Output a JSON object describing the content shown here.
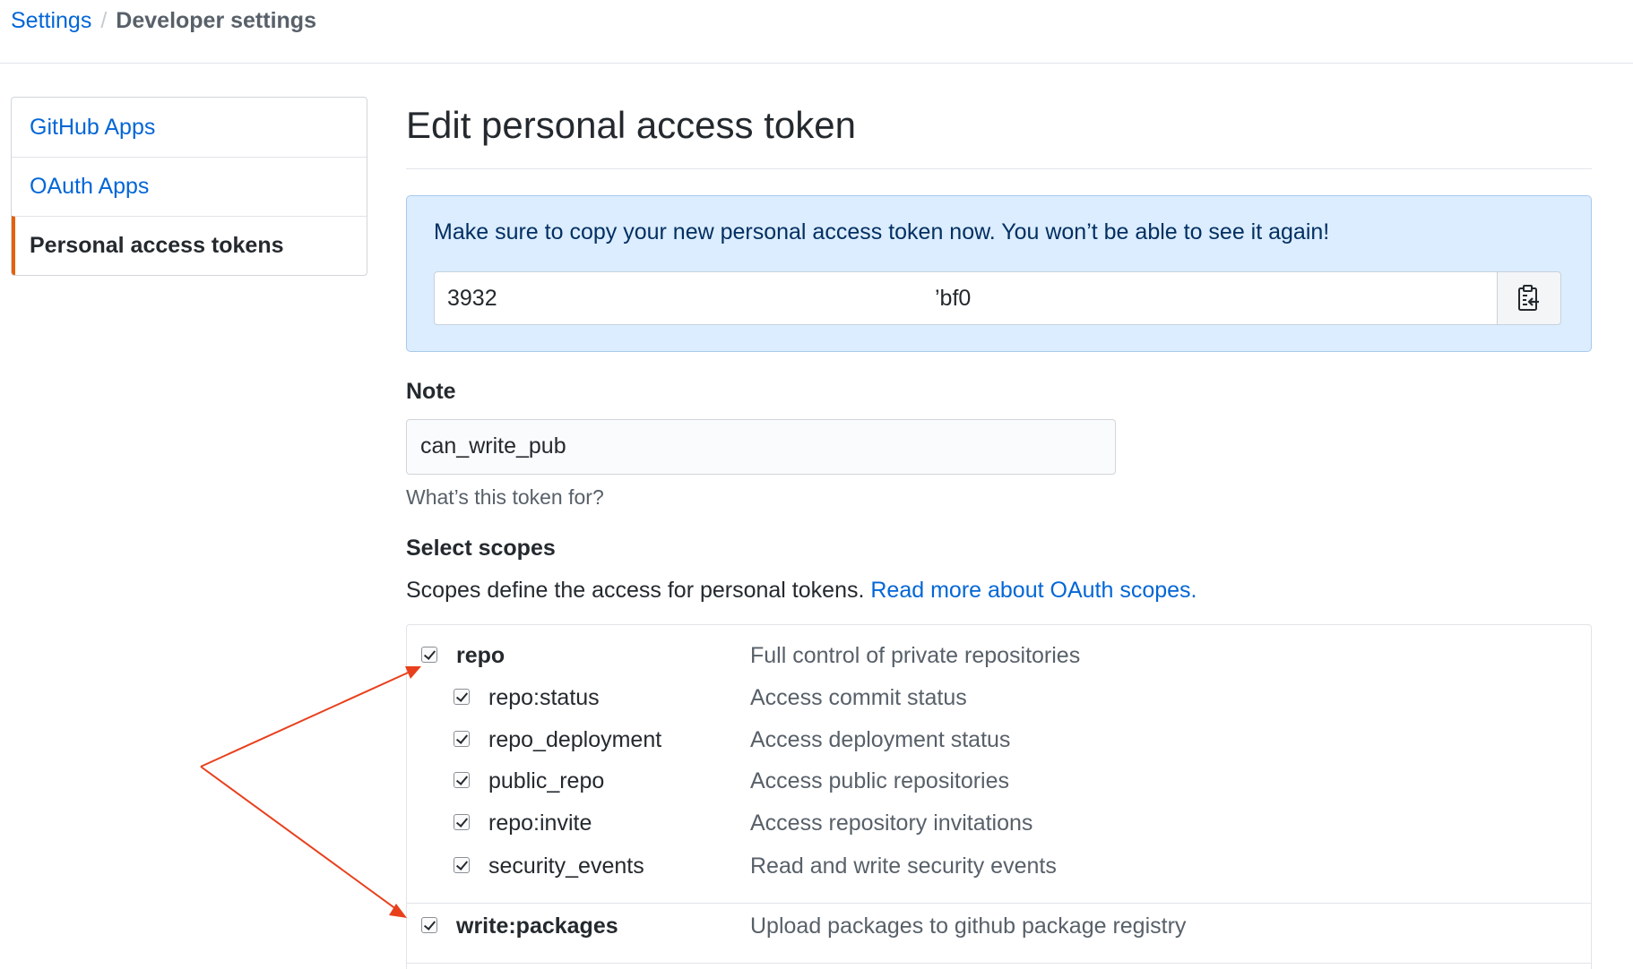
{
  "breadcrumb": {
    "root": "Settings",
    "separator": "/",
    "current": "Developer settings"
  },
  "sidebar": {
    "items": [
      {
        "label": "GitHub Apps"
      },
      {
        "label": "OAuth Apps"
      },
      {
        "label": "Personal access tokens"
      }
    ]
  },
  "page": {
    "title": "Edit personal access token"
  },
  "flash": {
    "message": "Make sure to copy your new personal access token now. You won’t be able to see it again!",
    "token_start": "3932",
    "token_end": "’bf0",
    "copy_icon": "clipboard-icon"
  },
  "note": {
    "label": "Note",
    "value": "can_write_pub",
    "hint": "What’s this token for?"
  },
  "scopes": {
    "title": "Select scopes",
    "description": "Scopes define the access for personal tokens.",
    "link": "Read more about OAuth scopes.",
    "items": [
      {
        "name": "repo",
        "description": "Full control of private repositories",
        "checked": true
      },
      {
        "name": "repo:status",
        "description": "Access commit status",
        "checked": true
      },
      {
        "name": "repo_deployment",
        "description": "Access deployment status",
        "checked": true
      },
      {
        "name": "public_repo",
        "description": "Access public repositories",
        "checked": true
      },
      {
        "name": "repo:invite",
        "description": "Access repository invitations",
        "checked": true
      },
      {
        "name": "security_events",
        "description": "Read and write security events",
        "checked": true
      },
      {
        "name": "write:packages",
        "description": "Upload packages to github package registry",
        "checked": true
      }
    ]
  },
  "annotation": {
    "arrow_color": "#e8401c"
  }
}
